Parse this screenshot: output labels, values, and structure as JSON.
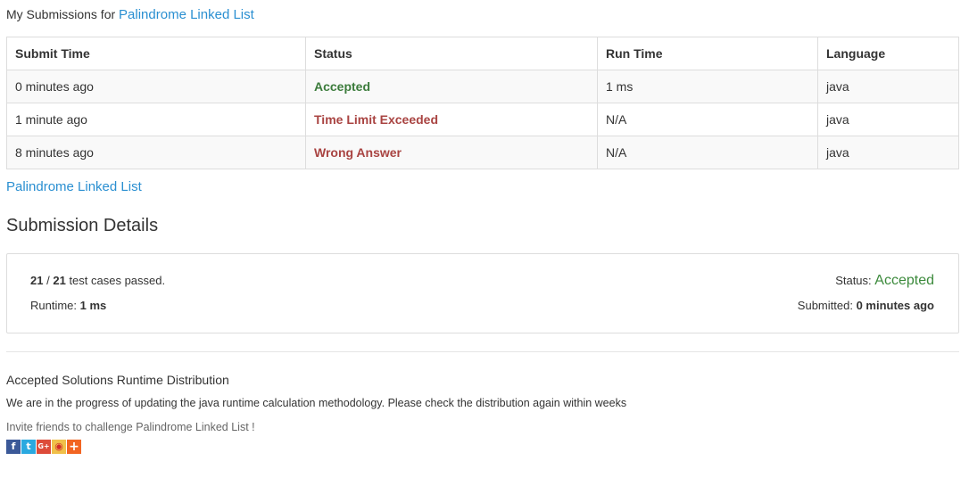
{
  "header": {
    "prefix": "My Submissions for",
    "problem_link": "Palindrome Linked List"
  },
  "table": {
    "columns": [
      "Submit Time",
      "Status",
      "Run Time",
      "Language"
    ],
    "rows": [
      {
        "submit_time": "0 minutes ago",
        "status": "Accepted",
        "run_time": "1 ms",
        "language": "java"
      },
      {
        "submit_time": "1 minute ago",
        "status": "Time Limit Exceeded",
        "run_time": "N/A",
        "language": "java"
      },
      {
        "submit_time": "8 minutes ago",
        "status": "Wrong Answer",
        "run_time": "N/A",
        "language": "java"
      }
    ]
  },
  "problem_link_bottom": "Palindrome Linked List",
  "details": {
    "title": "Submission Details",
    "passed": "21",
    "slash": "/",
    "total": "21",
    "passed_suffix": "test cases passed.",
    "runtime_label": "Runtime:",
    "runtime_value": "1 ms",
    "status_label": "Status:",
    "status_value": "Accepted",
    "submitted_label": "Submitted:",
    "submitted_value": "0 minutes ago"
  },
  "distribution": {
    "title": "Accepted Solutions Runtime Distribution",
    "note": "We are in the progress of updating the java runtime calculation methodology. Please check the distribution again within weeks",
    "invite": "Invite friends to challenge Palindrome Linked List !"
  },
  "share_icons": [
    {
      "name": "facebook-icon",
      "glyph": "f"
    },
    {
      "name": "twitter-icon",
      "glyph": "t"
    },
    {
      "name": "google-plus-icon",
      "glyph": "G+"
    },
    {
      "name": "weibo-icon",
      "glyph": "◉"
    },
    {
      "name": "add-share-icon",
      "glyph": "+"
    }
  ],
  "colors": {
    "link": "#2a8fd1",
    "accepted": "#3c7c3c",
    "error": "#a94442"
  }
}
